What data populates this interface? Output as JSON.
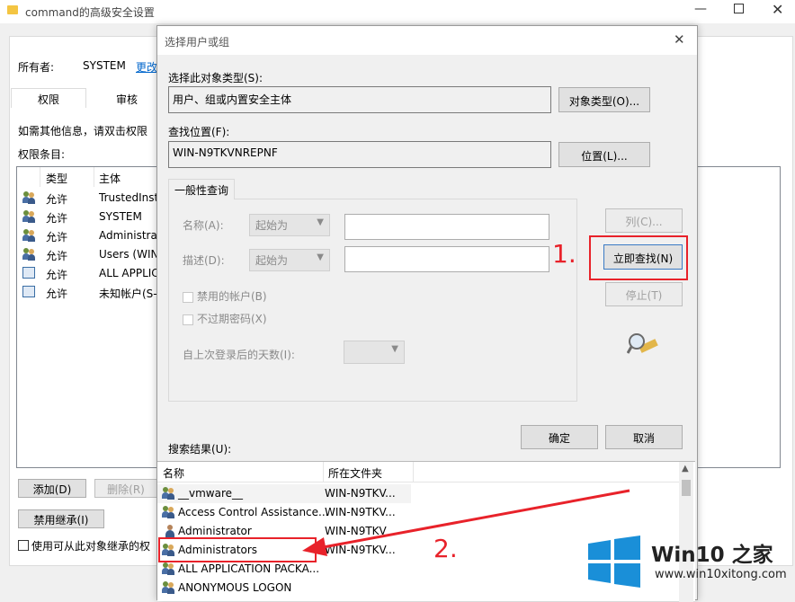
{
  "bg": {
    "title": "command的高级安全设置",
    "owner_label": "所有者:",
    "owner_value": "SYSTEM",
    "owner_change": "更改",
    "tabs": [
      "权限",
      "审核"
    ],
    "info": "如需其他信息，请双击权限",
    "entries_label": "权限条目:",
    "headers": {
      "type": "类型",
      "principal": "主体"
    },
    "entries": [
      {
        "type": "允许",
        "principal": "TrustedInst"
      },
      {
        "type": "允许",
        "principal": "SYSTEM"
      },
      {
        "type": "允许",
        "principal": "Administrat"
      },
      {
        "type": "允许",
        "principal": "Users (WIN"
      },
      {
        "type": "允许",
        "principal": "ALL APPLIC"
      },
      {
        "type": "允许",
        "principal": "未知帐户(S-"
      }
    ],
    "add": "添加(D)",
    "remove": "删除(R)",
    "disable_inherit": "禁用继承(I)",
    "use_inherit": "使用可从此对象继承的权"
  },
  "dialog": {
    "title": "选择用户或组",
    "object_type_label": "选择此对象类型(S):",
    "object_type_value": "用户、组或内置安全主体",
    "object_type_btn": "对象类型(O)...",
    "location_label": "查找位置(F):",
    "location_value": "WIN-N9TKVNREPNF",
    "location_btn": "位置(L)...",
    "query_tab": "一般性查询",
    "name_label": "名称(A):",
    "name_combo": "起始为",
    "desc_label": "描述(D):",
    "desc_combo": "起始为",
    "disabled_accounts": "禁用的帐户(B)",
    "no_expire": "不过期密码(X)",
    "days_label": "自上次登录后的天数(I):",
    "columns_btn": "列(C)...",
    "find_now_btn": "立即查找(N)",
    "stop_btn": "停止(T)",
    "ok_btn": "确定",
    "cancel_btn": "取消",
    "results_label": "搜索结果(U):",
    "results_headers": {
      "name": "名称",
      "folder": "所在文件夹"
    },
    "results": [
      {
        "name": "__vmware__",
        "folder": "WIN-N9TKV..."
      },
      {
        "name": "Access Control Assistance...",
        "folder": "WIN-N9TKV..."
      },
      {
        "name": "Administrator",
        "folder": "WIN-N9TKV"
      },
      {
        "name": "Administrators",
        "folder": "WIN-N9TKV..."
      },
      {
        "name": "ALL APPLICATION PACKA...",
        "folder": ""
      },
      {
        "name": "ANONYMOUS LOGON",
        "folder": ""
      }
    ]
  },
  "annotations": {
    "step1": "1.",
    "step2": "2."
  },
  "watermark": {
    "brand": "Win10 之家",
    "url": "www.win10xitong.com"
  },
  "colors": {
    "annotation_red": "#e8222a",
    "win_blue": "#1a8fd8"
  }
}
